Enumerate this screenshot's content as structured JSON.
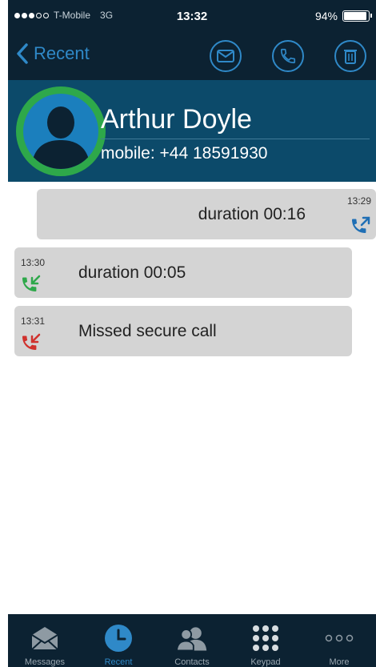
{
  "status_bar": {
    "carrier": "T-Mobile",
    "network": "3G",
    "time": "13:32",
    "battery_percent": "94%",
    "battery_level": 0.94
  },
  "nav": {
    "back_label": "Recent"
  },
  "contact": {
    "name": "Arthur Doyle",
    "phone": "mobile: +44 18591930"
  },
  "calls": [
    {
      "time": "13:29",
      "text": "duration 00:16",
      "direction": "outgoing",
      "color": "#1f6fb5"
    },
    {
      "time": "13:30",
      "text": "duration 00:05",
      "direction": "incoming",
      "color": "#2ea84a"
    },
    {
      "time": "13:31",
      "text": "Missed secure call",
      "direction": "missed",
      "color": "#d0312d"
    }
  ],
  "tabs": [
    {
      "label": "Messages",
      "icon": "envelope-icon"
    },
    {
      "label": "Recent",
      "icon": "clock-icon",
      "active": true
    },
    {
      "label": "Contacts",
      "icon": "contacts-icon"
    },
    {
      "label": "Keypad",
      "icon": "keypad-icon"
    },
    {
      "label": "More",
      "icon": "more-icon"
    }
  ],
  "colors": {
    "bar_bg": "#0c2232",
    "header_bg": "#0c4a6a",
    "accent": "#2f89c8",
    "avatar_ring": "#2ea84a"
  }
}
